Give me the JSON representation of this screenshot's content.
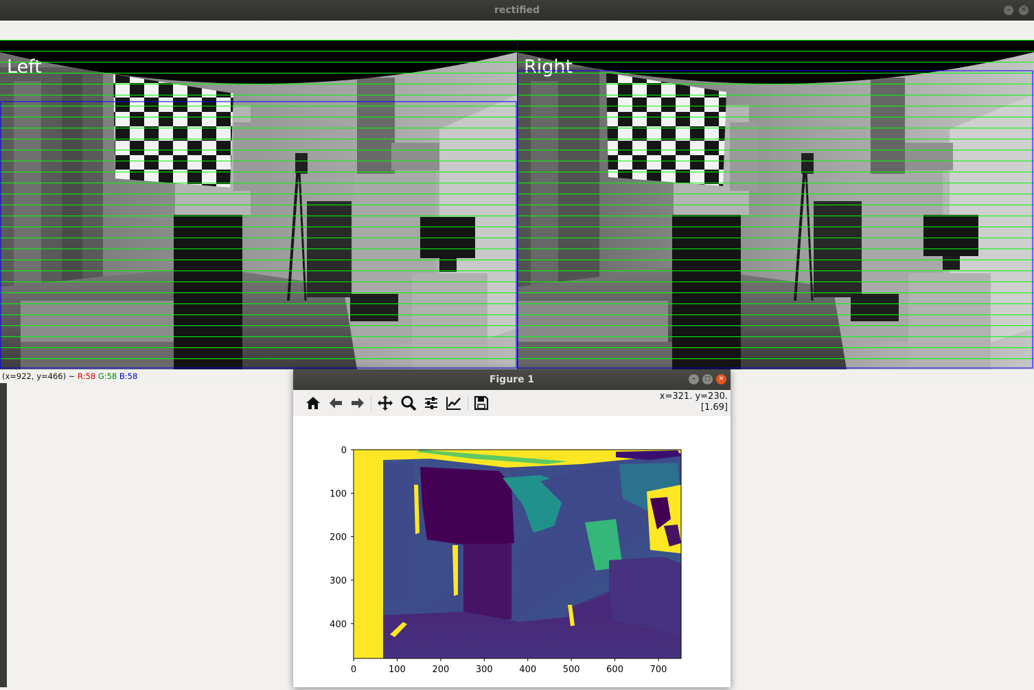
{
  "main_window": {
    "title": "rectified",
    "left_label": "Left",
    "right_label": "Right",
    "status": {
      "coords": "(x=922, y=466) ~",
      "r": "R:58",
      "g": "G:58",
      "b": "B:58"
    }
  },
  "figure_window": {
    "title": "Figure 1",
    "toolbar": [
      "home-icon",
      "back-icon",
      "forward-icon",
      "pan-icon",
      "zoom-icon",
      "configure-subplots-icon",
      "edit-axis-icon",
      "save-icon"
    ],
    "coords_line1": "x=321. y=230.",
    "coords_line2": "[1.69]"
  },
  "colors": {
    "epiline": "#00ff00",
    "roi_box": "#0000ff",
    "viridis_yellow": "#fde725",
    "viridis_dark": "#440154"
  },
  "chart_data": {
    "type": "heatmap",
    "title": "",
    "xlabel": "",
    "ylabel": "",
    "x_ticks": [
      0,
      100,
      200,
      300,
      400,
      500,
      600,
      700
    ],
    "y_ticks": [
      0,
      100,
      200,
      300,
      400
    ],
    "xlim": [
      0,
      752
    ],
    "ylim": [
      480,
      0
    ],
    "colormap": "viridis",
    "grid": false
  }
}
